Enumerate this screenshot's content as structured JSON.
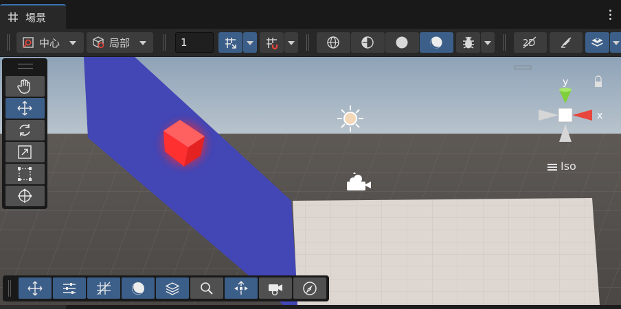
{
  "tab": {
    "label": "場景",
    "icon": "grid-icon"
  },
  "toolbar": {
    "pivot_label": "中心",
    "space_label": "局部",
    "increment_value": "1"
  },
  "gizmo": {
    "y_label": "y",
    "x_label": "x",
    "projection_label": "Iso"
  },
  "colors": {
    "accent": "#3c5f8a",
    "blue_plane": "#4346b5",
    "red_cube": "#ff3030",
    "floor": "#ddd6d1",
    "axis_y": "#7fd03b",
    "axis_x": "#e8453c"
  },
  "tools": [
    "hand-tool",
    "move-tool",
    "rotate-tool",
    "scale-tool",
    "rect-tool",
    "transform-tool"
  ],
  "overlays": [
    "tool-settings",
    "grid-and-snap",
    "grid-visibility",
    "shading-mode",
    "draw-mode",
    "search",
    "view-options",
    "cameras",
    "orientation"
  ]
}
